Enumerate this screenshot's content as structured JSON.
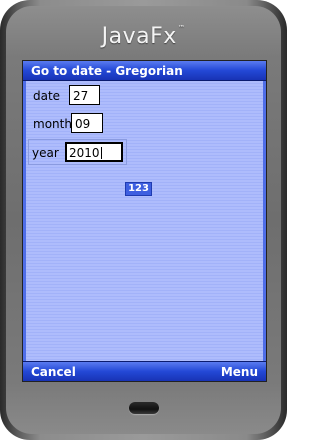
{
  "device": {
    "logo_text": "JavaFx",
    "logo_mark": "™"
  },
  "screen": {
    "title": "Go to date - Gregorian",
    "fields": {
      "date": {
        "label": "date",
        "value": "27"
      },
      "month": {
        "label": "month",
        "value": "09"
      },
      "year": {
        "label": "year",
        "value": "2010"
      }
    },
    "input_mode": "123",
    "softkeys": {
      "left": "Cancel",
      "right": "Menu"
    }
  },
  "colors": {
    "title_bar": "#2348d6",
    "content_bg": "#a9b8fb",
    "device_body": "#8e8e8e"
  }
}
